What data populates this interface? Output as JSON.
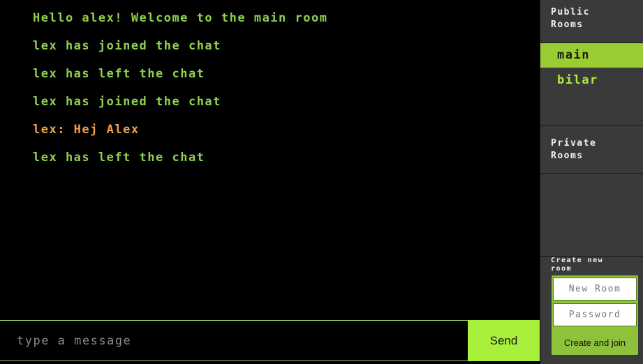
{
  "chat": {
    "messages": [
      {
        "text": "Hello alex! Welcome to the main room",
        "kind": "system"
      },
      {
        "text": "lex has joined the chat",
        "kind": "system"
      },
      {
        "text": "lex has left the chat",
        "kind": "system"
      },
      {
        "text": "lex has joined the chat",
        "kind": "system"
      },
      {
        "text": "lex: Hej Alex",
        "kind": "user"
      },
      {
        "text": "lex has left the chat",
        "kind": "system"
      }
    ]
  },
  "composer": {
    "placeholder": "type a message",
    "send_label": "Send"
  },
  "sidebar": {
    "public_title": "Public\nRooms",
    "public_rooms": [
      {
        "label": "main",
        "active": true
      },
      {
        "label": "bilar",
        "active": false
      }
    ],
    "private_title": "Private\nRooms",
    "create_title": "Create new\nroom",
    "new_room_placeholder": "New Room",
    "password_placeholder": "Password",
    "create_label": "Create and join"
  },
  "colors": {
    "system_text": "#8fd14f",
    "user_text": "#f0a050",
    "accent": "#a8f03c",
    "active_room": "#9acd32",
    "sidebar_bg": "#3a3a3a"
  }
}
